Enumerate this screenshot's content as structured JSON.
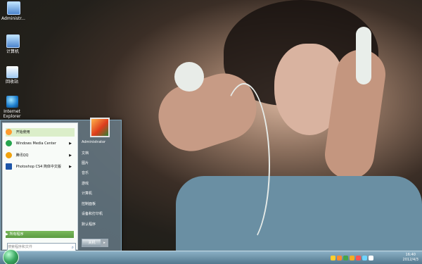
{
  "desktop": {
    "icons": [
      {
        "label": "Administr..."
      },
      {
        "label": "计算机"
      },
      {
        "label": "回收站"
      },
      {
        "label": "Internet Explorer"
      }
    ]
  },
  "start_menu": {
    "left_items": [
      {
        "label": "开始使用",
        "icon_color": "#ff9b2f"
      },
      {
        "label": "Windows Media Center",
        "icon_color": "#25a44e"
      },
      {
        "label": "腾讯QQ",
        "icon_color": "#f0a20e"
      },
      {
        "label": "Photoshop CS4 简体中文版",
        "icon_color": "#1d55a8"
      }
    ],
    "all_programs": "所有程序",
    "search_placeholder": "搜索程序和文件",
    "right_items": [
      "Administrator",
      "文档",
      "图片",
      "音乐",
      "游戏",
      "计算机",
      "控制面板",
      "设备和打印机",
      "默认程序"
    ],
    "shutdown": "关机"
  },
  "taskbar": {
    "time": "16:40",
    "date": "2012/4/3",
    "tray_colors": [
      "#ffcf2d",
      "#ff8b2e",
      "#46a54a",
      "#f4ad24",
      "#ff5454",
      "#6fd4ff",
      "#ffffff"
    ]
  }
}
